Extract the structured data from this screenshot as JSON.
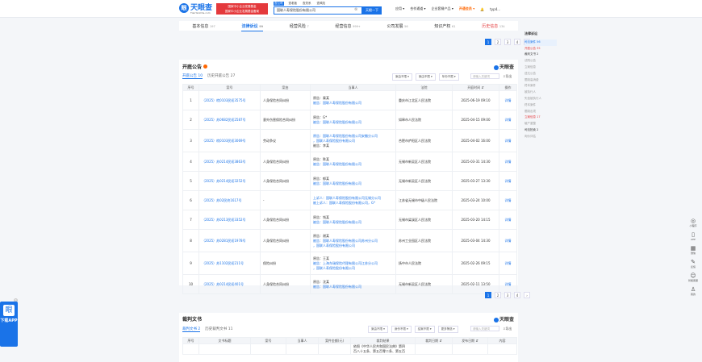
{
  "header": {
    "logo_text": "天眼查",
    "logo_sub": "TianYanCha.com",
    "banner_line1": "国家中小企业发展基金",
    "banner_line2": "国家中小企业发展基金备案",
    "search_tabs": [
      "查公司",
      "查老板",
      "查关系",
      "查风险"
    ],
    "search_value": "国联人寿保险股份有限公司",
    "search_button": "天眼一下",
    "nav": [
      "应用 ▾",
      "合作通道 ▾",
      "企业套餐产品 ▾",
      "开通会员 ▾",
      "typ4..."
    ],
    "bell_icon": "bell-icon"
  },
  "tabs": [
    {
      "label": "基本信息",
      "count": "197",
      "active": false
    },
    {
      "label": "法律诉讼",
      "count": "99",
      "active": true
    },
    {
      "label": "经营风险",
      "count": "7",
      "active": false
    },
    {
      "label": "经营信息",
      "count": "999+",
      "active": false
    },
    {
      "label": "公司发展",
      "count": "56",
      "active": false
    },
    {
      "label": "知识产权",
      "count": "61",
      "active": false
    },
    {
      "label": "历史信息",
      "count": "134",
      "active": false
    }
  ],
  "pager_top": [
    "1",
    "2",
    "3",
    "4",
    "›"
  ],
  "section1": {
    "title": "开庭公告",
    "brand": "天眼查",
    "subtabs": [
      "开庭公告 10",
      "历史开庭公告 27"
    ],
    "filters": [
      "案由不限 ▾",
      "案由不限 ▾",
      "年份不限 ▾"
    ],
    "search_placeholder": "请输入关键词",
    "export": "导出",
    "headers": [
      "序号",
      "案号",
      "案由",
      "当事人",
      "法院",
      "开庭时间 ⇵",
      "操作"
    ],
    "rows": [
      {
        "no": "1",
        "case": "（2025）皖0103民初3575号",
        "reason": "人身保险合同纠纷",
        "parties": [
          "原告：秦某",
          "被告：国联人寿保险股份有限公司"
        ],
        "court": "重庆市江北区人民法院",
        "time": "2025-06-19 09:10",
        "action": "详情"
      },
      {
        "no": "2",
        "case": "（2025）苏0682民初2587号",
        "reason": "意外伤害保险合同纠纷",
        "parties": [
          "原告：G*",
          "被告：国联人寿保险股份有限公司"
        ],
        "court": "如皋市人民法院",
        "time": "2025-04-15 09:00",
        "action": "详情"
      },
      {
        "no": "3",
        "case": "（2025）皖0103民初3069号",
        "reason": "劳动争议",
        "parties": [
          "原告：国联人寿保险股份有限公司安徽分公司",
          "，国联人寿保险股份有限公司",
          "被告：李某"
        ],
        "court": "合肥市庐阳区人民法院",
        "time": "2025-04-02 16:00",
        "action": "详情"
      },
      {
        "no": "4",
        "case": "（2025）苏0214民初3863号",
        "reason": "人身保险合同纠纷",
        "parties": [
          "原告：陈某",
          "被告：国联人寿保险股份有限公司"
        ],
        "court": "无锡市新吴区人民法院",
        "time": "2025-03-31 14:30",
        "action": "详情"
      },
      {
        "no": "5",
        "case": "（2025）苏0214民初3252号",
        "reason": "人身保险合同纠纷",
        "parties": [
          "原告：郁某",
          "被告：国联人寿保险股份有限公司"
        ],
        "court": "无锡市新吴区人民法院",
        "time": "2025-03-27 13:30",
        "action": "详情"
      },
      {
        "no": "6",
        "case": "（2025）苏02民终1617号",
        "reason": "-",
        "parties": [
          "上诉人：国联人寿保险股份有限公司无锡分公司",
          "被上诉人：国联人寿保险股份有限公司，G*"
        ],
        "court": "江苏省无锡市中级人民法院",
        "time": "2025-03-24 10:00",
        "action": "详情"
      },
      {
        "no": "7",
        "case": "（2025）苏0213民初3352号",
        "reason": "人身保险合同纠纷",
        "parties": [
          "原告：钱某",
          "被告：国联人寿保险股份有限公司"
        ],
        "court": "无锡市梁溪区人民法院",
        "time": "2025-03-20 14:15",
        "action": "详情"
      },
      {
        "no": "8",
        "case": "（2025）苏0281民初1978号",
        "reason": "人身保险合同纠纷",
        "parties": [
          "原告：谢某",
          "被告：国联人寿保险股份有限公司苏州分公司",
          "，国联人寿保险股份有限公司"
        ],
        "court": "苏州工业园区人民法院",
        "time": "2025-03-04 14:30",
        "action": "详情"
      },
      {
        "no": "9",
        "case": "（2025）苏1102民初211号",
        "reason": "保险纠纷",
        "parties": [
          "原告：王某",
          "被告：上海东瑞保险代理有限公司江苏分公司",
          "，国联人寿保险股份有限公司"
        ],
        "court": "扬中市人民法院",
        "time": "2025-02-26 09:15",
        "action": "详情"
      },
      {
        "no": "10",
        "case": "（2025）苏0214民初401号",
        "reason": "人身保险合同纠纷",
        "parties": [
          "原告：沈某",
          "被告：国联人寿保险股份有限公司"
        ],
        "court": "无锡市新吴区人民法院",
        "time": "2025-02-11 13:50",
        "action": "详情"
      }
    ]
  },
  "pager_mid": [
    "1",
    "2",
    "3",
    "4",
    "›"
  ],
  "section2": {
    "title": "裁判文书",
    "brand": "天眼查",
    "subtabs": [
      "裁判文书 2",
      "历史裁判文书 11"
    ],
    "filters": [
      "案由不限 ▾",
      "身份不限 ▾",
      "结案不限 ▾",
      "更多筛选 ▾"
    ],
    "search_placeholder": "请输入关键词",
    "export": "导出",
    "headers": [
      "序号",
      "文书标题",
      "案号",
      "当事人",
      "案件金额(元)",
      "裁判结果",
      "裁判日期 ⇵",
      "发布日期 ⇵",
      "内容"
    ],
    "row_preview": [
      "依照《中华人民共和国民法典》第四",
      "百八十五条、第五百零二条、第五百"
    ]
  },
  "sidebar": {
    "head": "法律诉讼",
    "items": [
      {
        "label": "司法案件 56",
        "state": "on"
      },
      {
        "label": "开庭公告 35",
        "state": "red"
      },
      {
        "label": "裁判文书 2",
        "state": "dark"
      },
      {
        "label": "法院公告",
        "state": ""
      },
      {
        "label": "立案信息",
        "state": ""
      },
      {
        "label": "送达公告",
        "state": ""
      },
      {
        "label": "限制高消费",
        "state": ""
      },
      {
        "label": "终本案件",
        "state": ""
      },
      {
        "label": "被执行人",
        "state": ""
      },
      {
        "label": "失信被执行人",
        "state": ""
      },
      {
        "label": "终本案件",
        "state": ""
      },
      {
        "label": "限制出境",
        "state": ""
      },
      {
        "label": "立案信息 17",
        "state": "red"
      },
      {
        "label": "破产重整",
        "state": ""
      },
      {
        "label": "司法拍卖 2",
        "state": "dark"
      },
      {
        "label": "询价评估",
        "state": ""
      }
    ]
  },
  "rightbar": [
    {
      "icon": "mini-program-icon",
      "label": "小程序"
    },
    {
      "icon": "app-icon",
      "label": "APP"
    },
    {
      "icon": "qr-icon",
      "label": "微信"
    },
    {
      "icon": "feedback-icon",
      "label": "反馈"
    },
    {
      "icon": "service-icon",
      "label": "智能客服"
    },
    {
      "icon": "user-icon",
      "label": "我的"
    }
  ],
  "app_float": {
    "label": "下载APP"
  }
}
